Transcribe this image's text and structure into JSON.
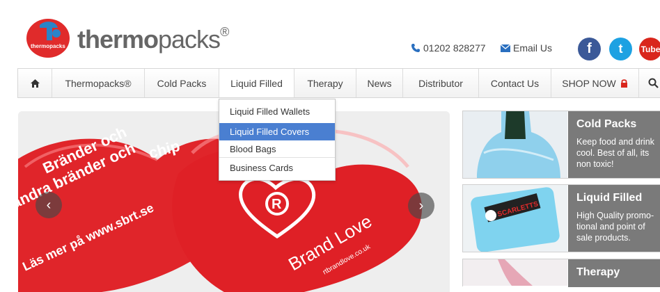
{
  "header": {
    "brand_bold": "thermo",
    "brand_light": "packs",
    "brand_reg": "®",
    "logo_text": "thermopacks",
    "phone": "01202 828277",
    "email": "Email Us",
    "social": [
      "f",
      "t",
      "Tube"
    ]
  },
  "nav": {
    "items": [
      "Thermopacks®",
      "Cold Packs",
      "Liquid Filled",
      "Therapy",
      "News",
      "Distributor",
      "Contact Us",
      "SHOP NOW"
    ]
  },
  "dropdown": {
    "items": [
      "Liquid Filled Wallets",
      "Liquid Filled Covers",
      "Blood Bags",
      "Business Cards"
    ]
  },
  "slider": {
    "prev": "‹",
    "next": "›",
    "words": [
      "Brand Love",
      "rtbrandlove.co.uk",
      "R",
      "Läs mer på www.sbrt.se",
      "andra bränder och",
      "Bränder och",
      "chip"
    ]
  },
  "cards": [
    {
      "title": "Cold Packs",
      "text": "Keep food and drink cool. Best of all, its non toxic!"
    },
    {
      "title": "Liquid Filled",
      "text": "High Quality promo-tional and point of sale products."
    },
    {
      "title": "Therapy",
      "text": ""
    }
  ],
  "card_img_text": "SCARLETTS",
  "colors": {
    "accent": "#4a7fd1",
    "brand_red": "#e02b2b",
    "card_grey": "#7a7a7a",
    "facebook": "#3b5998",
    "twitter": "#1da1e2",
    "youtube": "#d9261c"
  }
}
